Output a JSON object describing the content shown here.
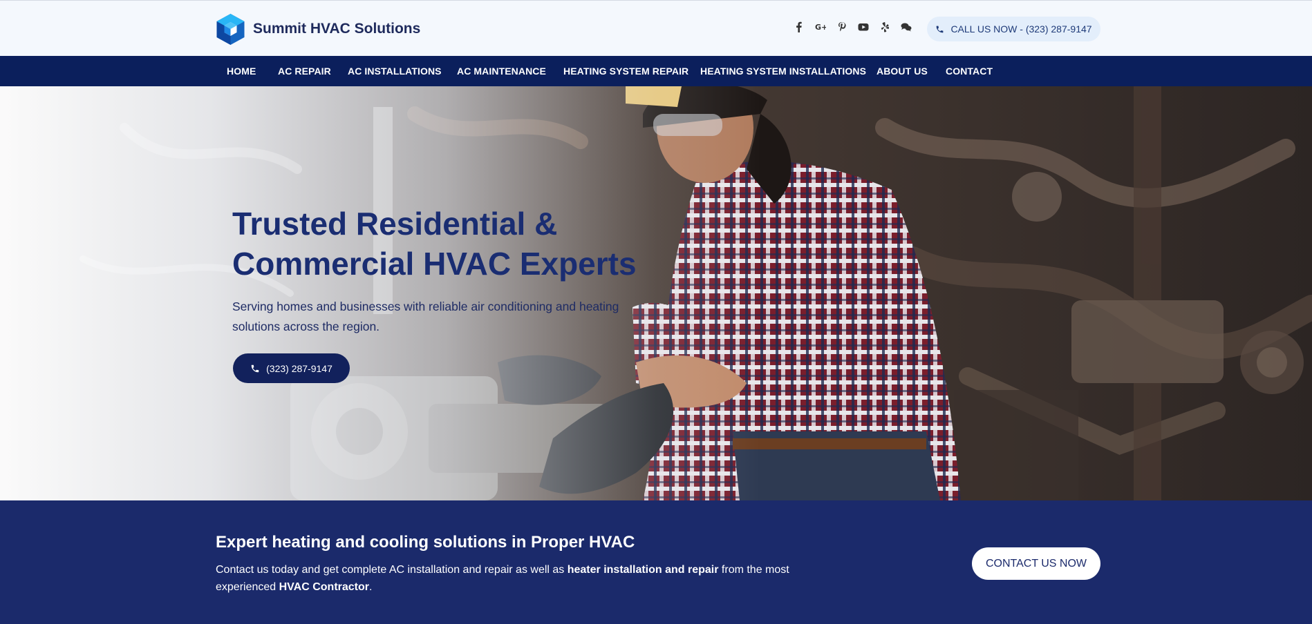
{
  "brand": {
    "name": "Summit HVAC Solutions",
    "logo_icon": "hexagon-cube-logo"
  },
  "header": {
    "social_icons": [
      "facebook-icon",
      "google-plus-icon",
      "pinterest-icon",
      "youtube-icon",
      "yelp-icon",
      "chat-icon"
    ],
    "call_label": "CALL US NOW - (323) 287-9147"
  },
  "nav": {
    "items": [
      "HOME",
      "AC REPAIR",
      "AC INSTALLATIONS",
      "AC MAINTENANCE",
      "HEATING SYSTEM REPAIR",
      "HEATING SYSTEM INSTALLATIONS",
      "ABOUT US",
      "CONTACT"
    ]
  },
  "hero": {
    "title_line1": "Trusted Residential &",
    "title_line2": "Commercial HVAC Experts",
    "subtitle": "Serving homes and businesses with reliable air conditioning and heating solutions across the region.",
    "phone": "(323) 287-9147"
  },
  "cta": {
    "title": "Expert heating and cooling solutions in Proper HVAC",
    "text_part1": "Contact us today and get complete AC installation and repair as well as ",
    "text_bold1": "heater installation and repair",
    "text_part2": " from the most experienced ",
    "text_bold2": "HVAC Contractor",
    "text_part3": ".",
    "button": "CONTACT US NOW"
  },
  "colors": {
    "nav_bg": "#0b1f5c",
    "cta_bg": "#1b2a6b",
    "hero_title": "#1a2d72",
    "accent_blue": "#1e88e5"
  }
}
